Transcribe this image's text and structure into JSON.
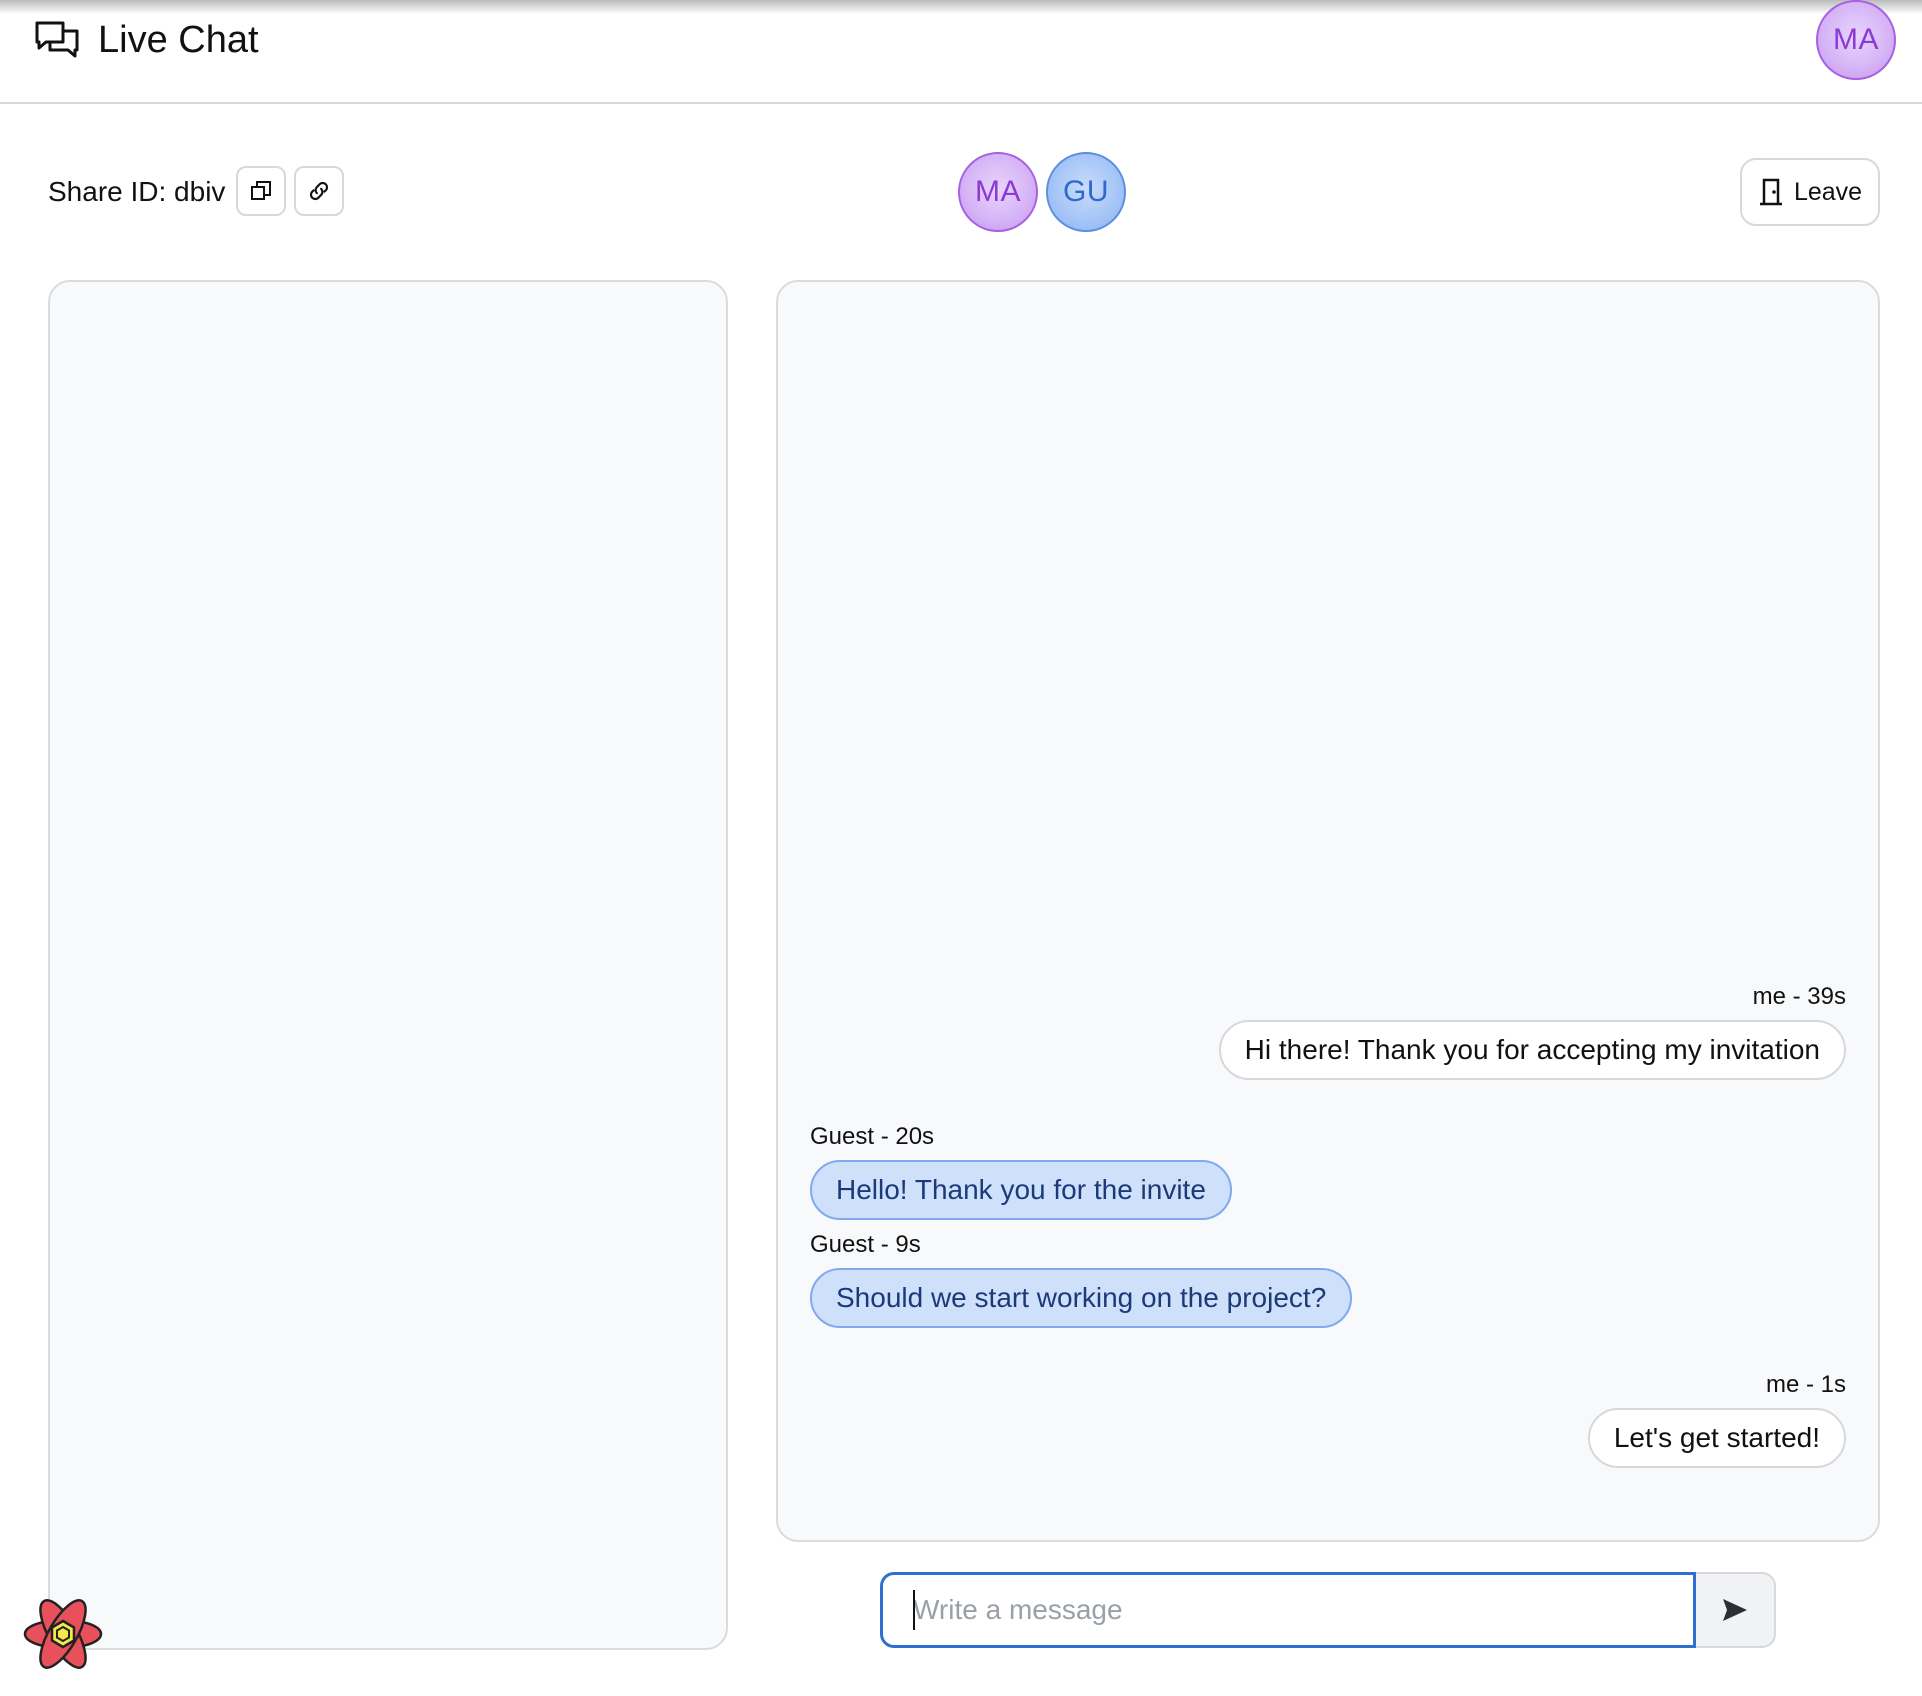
{
  "header": {
    "title": "Live Chat",
    "logo_icon": "chat-bubbles-icon",
    "user_avatar": "MA"
  },
  "room": {
    "share_label": "Share ID: dbiv",
    "copy_icon": "copy-icon",
    "link_icon": "link-icon",
    "participants": [
      "MA",
      "GU"
    ],
    "leave_label": "Leave",
    "leave_icon": "door-icon"
  },
  "messages": [
    {
      "sender": "me",
      "meta": "me - 39s",
      "text": "Hi there! Thank you for accepting my invitation"
    },
    {
      "sender": "guest",
      "meta": "Guest - 20s",
      "text": "Hello! Thank you for the invite"
    },
    {
      "sender": "guest",
      "meta": "Guest - 9s",
      "text": "Should we start working on the project?"
    },
    {
      "sender": "me",
      "meta": "me - 1s",
      "text": "Let's get started!"
    }
  ],
  "composer": {
    "placeholder": "Write a message",
    "value": "",
    "send_icon": "send-icon"
  },
  "colors": {
    "avatar_ma": "#d7b6f7",
    "avatar_gu": "#a7c6f7",
    "guest_bubble": "#cfe0fb",
    "input_focus": "#2f6fd0",
    "panel_bg": "#f8f9fb"
  },
  "dev_tools_icon": "react-devtools-icon"
}
